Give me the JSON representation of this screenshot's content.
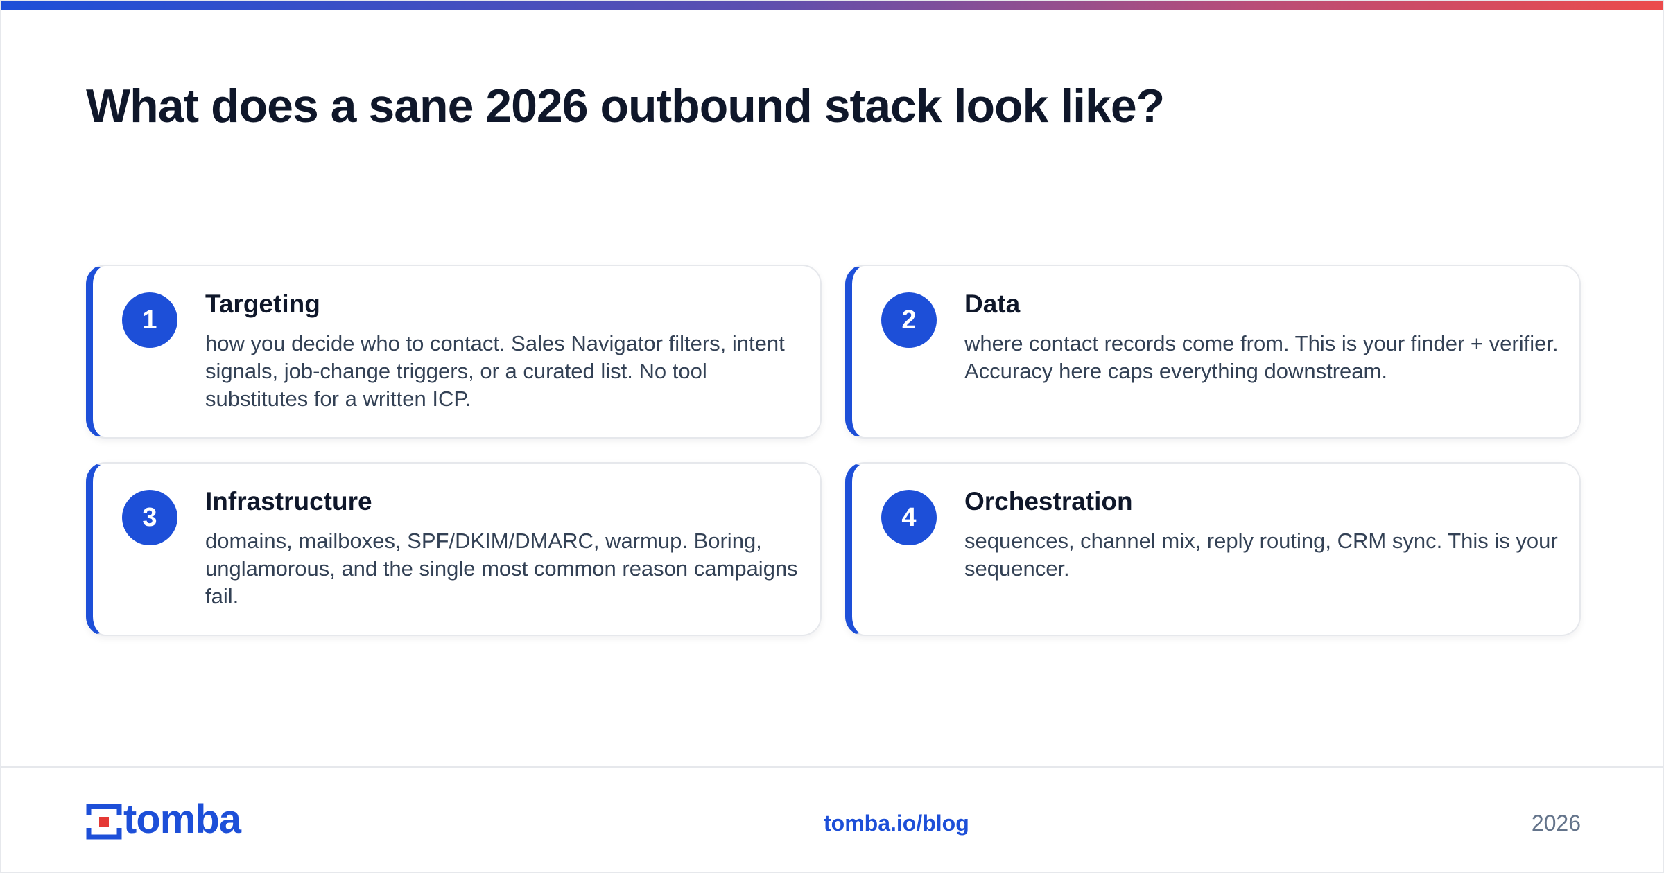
{
  "header": {
    "title": "What does a sane 2026 outbound stack look like?"
  },
  "cards": [
    {
      "number": "1",
      "title": "Targeting",
      "body": "how you decide who to contact. Sales Navigator filters, intent signals, job-change triggers, or a curated list. No tool substitutes for a written ICP."
    },
    {
      "number": "2",
      "title": "Data",
      "body": "where contact records come from. This is your finder + verifier. Accuracy here caps everything downstream."
    },
    {
      "number": "3",
      "title": "Infrastructure",
      "body": "domains, mailboxes, SPF/DKIM/DMARC, warmup. Boring, unglamorous, and the single most common reason campaigns fail."
    },
    {
      "number": "4",
      "title": "Orchestration",
      "body": "sequences, channel mix, reply routing, CRM sync. This is your sequencer."
    }
  ],
  "footer": {
    "logo_text": "tomba",
    "link": "tomba.io/blog",
    "year": "2026"
  },
  "colors": {
    "accent": "#1d4fd8",
    "logo_red": "#e53935",
    "title": "#0f172a",
    "body": "#334155",
    "muted": "#64748b",
    "gradient_start": "#1d4fd8",
    "gradient_end": "#ec4b4b"
  },
  "icons": {
    "logo": "tomba-logo-mark"
  }
}
